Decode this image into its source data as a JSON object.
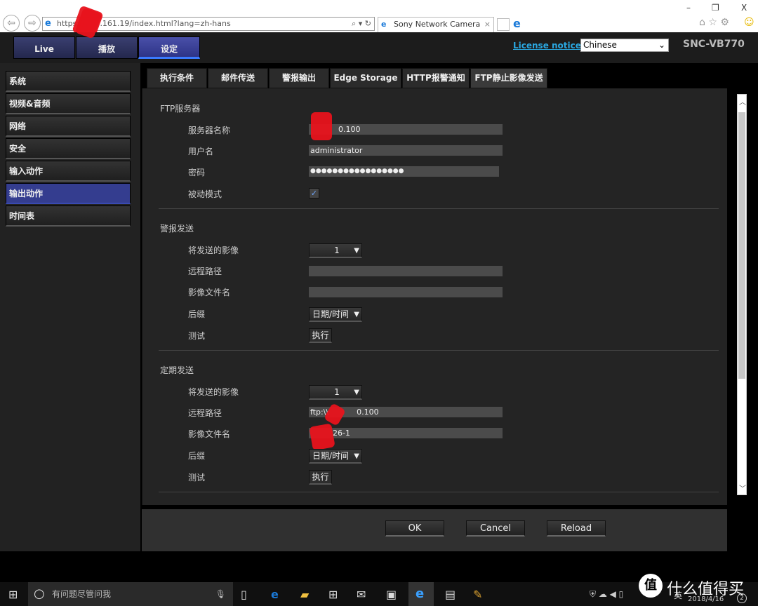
{
  "browser": {
    "url_prefix": "https://",
    "url_rest": ".161.19/index.html?lang=zh-hans",
    "tab_title": "Sony Network Camera",
    "tab_close": "×",
    "win_min": "–",
    "win_max": "❐",
    "win_close": "X"
  },
  "header": {
    "nav": [
      {
        "label": "Live"
      },
      {
        "label": "播放"
      },
      {
        "label": "设定"
      }
    ],
    "license": "License notice",
    "language": "Chinese",
    "model": "SNC-VB770"
  },
  "sidebar": {
    "items": [
      {
        "label": "系统"
      },
      {
        "label": "视频&音频"
      },
      {
        "label": "网络"
      },
      {
        "label": "安全"
      },
      {
        "label": "输入动作"
      },
      {
        "label": "输出动作",
        "active": true
      },
      {
        "label": "时间表"
      }
    ]
  },
  "tabs": [
    {
      "label": "执行条件"
    },
    {
      "label": "邮件传送"
    },
    {
      "label": "警报输出"
    },
    {
      "label": "Edge Storage"
    },
    {
      "label": "HTTP报警通知"
    },
    {
      "label": "FTP静止影像发送",
      "active": true
    }
  ],
  "ftp_server": {
    "title": "FTP服务器",
    "server_label": "服务器名称",
    "server_value": "0.100",
    "user_label": "用户名",
    "user_value": "administrator",
    "password_label": "密码",
    "password_value": "●●●●●●●●●●●●●●●●●",
    "passive_label": "被动模式",
    "passive_checked": true
  },
  "alarm_send": {
    "title": "警报发送",
    "image_label": "将发送的影像",
    "image_value": "1",
    "path_label": "远程路径",
    "path_value": "",
    "file_label": "影像文件名",
    "file_value": "",
    "suffix_label": "后缀",
    "suffix_value": "日期/时间",
    "test_label": "测试",
    "run_label": "执行"
  },
  "periodic_send": {
    "title": "定期发送",
    "image_label": "将发送的影像",
    "image_value": "1",
    "path_label": "远程路径",
    "path_value_a": "ftp:\\\\",
    "path_value_b": "0.100",
    "file_label": "影像文件名",
    "file_value": "26-1",
    "suffix_label": "后缀",
    "suffix_value": "日期/时间",
    "test_label": "测试",
    "run_label": "执行"
  },
  "footer": {
    "ok": "OK",
    "cancel": "Cancel",
    "reload": "Reload"
  },
  "taskbar": {
    "search_placeholder": "有问题尽管问我",
    "lang": "英",
    "date": "2018/4/16",
    "watermark": "什么值得买",
    "badge": "2"
  },
  "colors": {
    "accent": "#343d8f",
    "link": "#2aa7e0",
    "redaction": "#e8131c"
  }
}
